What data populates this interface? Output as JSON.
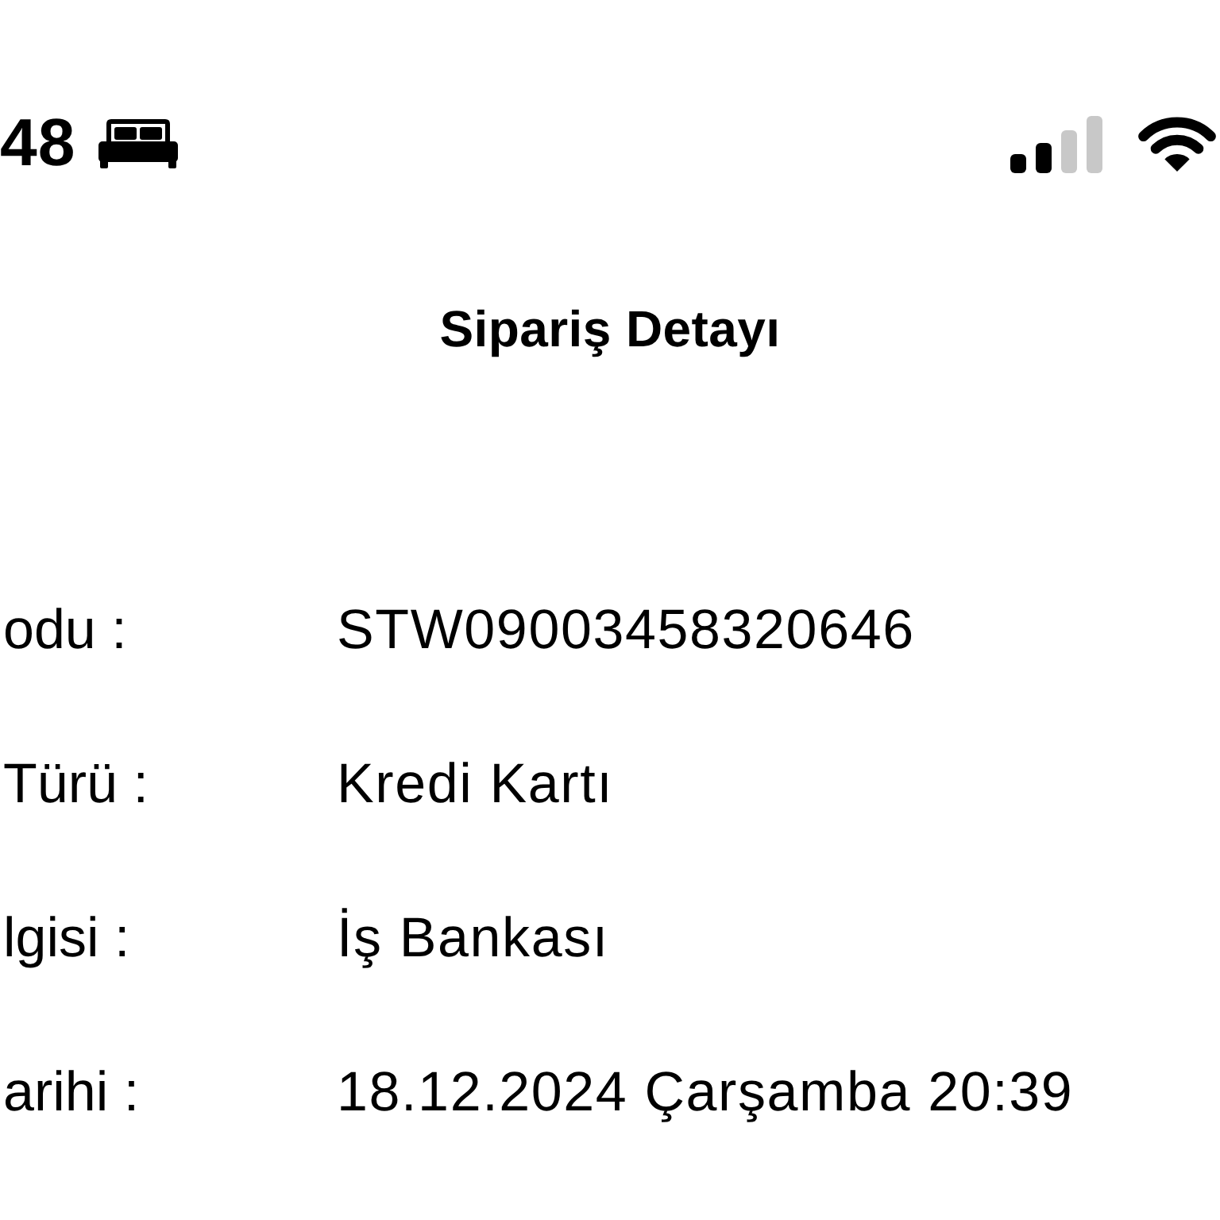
{
  "status_bar": {
    "time": "48"
  },
  "title": "Sipariş Detayı",
  "details": [
    {
      "label": "odu :",
      "value": "STW09003458320646"
    },
    {
      "label": "Türü :",
      "value": "Kredi Kartı"
    },
    {
      "label": "lgisi :",
      "value": "İş Bankası"
    },
    {
      "label": "arihi :",
      "value": "18.12.2024 Çarşamba 20:39"
    }
  ]
}
